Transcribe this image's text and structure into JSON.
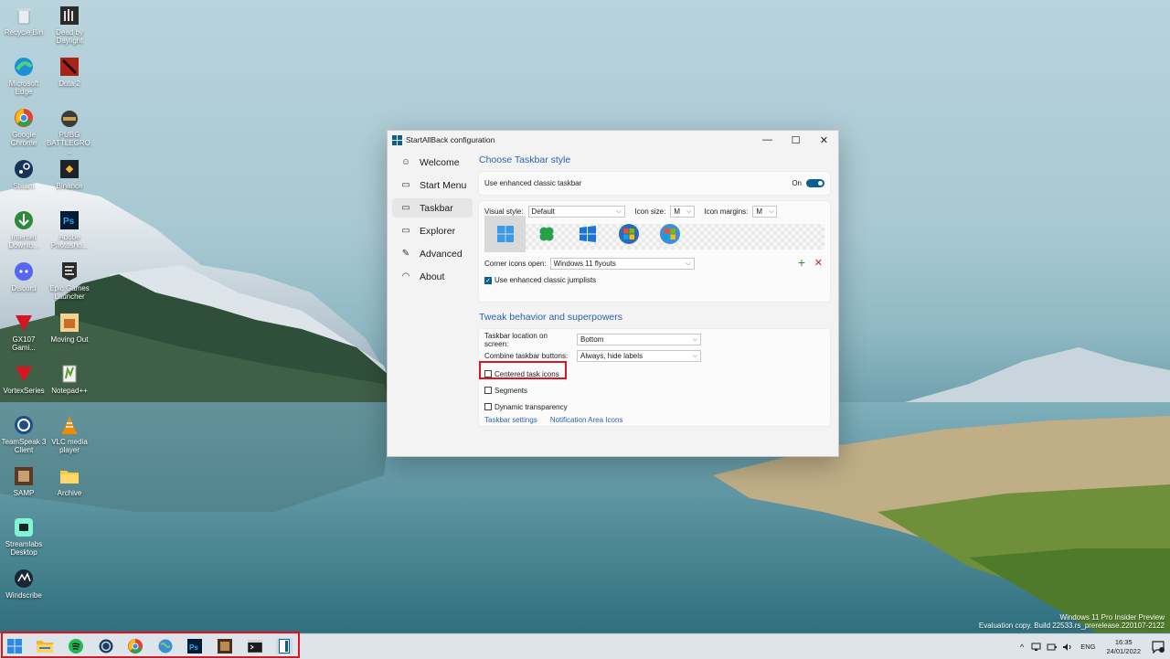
{
  "desktop": {
    "icons": [
      {
        "label": "Recycle Bin",
        "icon": "recycle-bin-icon"
      },
      {
        "label": "Dead by Daylight",
        "icon": "game-icon"
      },
      {
        "label": "Microsoft Edge",
        "icon": "edge-icon"
      },
      {
        "label": "Dota 2",
        "icon": "dota-icon"
      },
      {
        "label": "Google Chrome",
        "icon": "chrome-icon"
      },
      {
        "label": "PUBG BATTLEGRO...",
        "icon": "pubg-icon"
      },
      {
        "label": "Steam",
        "icon": "steam-icon"
      },
      {
        "label": "Binance",
        "icon": "binance-icon"
      },
      {
        "label": "Internet Downlo...",
        "icon": "idm-icon"
      },
      {
        "label": "Adobe Photosho...",
        "icon": "photoshop-icon"
      },
      {
        "label": "Discord",
        "icon": "discord-icon"
      },
      {
        "label": "Epic Games Launcher",
        "icon": "epic-icon"
      },
      {
        "label": "GX107 Gami...",
        "icon": "gx-icon"
      },
      {
        "label": "Moving Out",
        "icon": "moving-out-icon"
      },
      {
        "label": "VortexSeries",
        "icon": "vortex-icon"
      },
      {
        "label": "Notepad++",
        "icon": "notepadpp-icon"
      },
      {
        "label": "TeamSpeak 3 Client",
        "icon": "teamspeak-icon"
      },
      {
        "label": "VLC media player",
        "icon": "vlc-icon"
      },
      {
        "label": "SAMP",
        "icon": "samp-icon"
      },
      {
        "label": "Archive",
        "icon": "folder-icon"
      },
      {
        "label": "Streamlabs Desktop",
        "icon": "streamlabs-icon"
      },
      {
        "label": "Windscribe",
        "icon": "windscribe-icon"
      }
    ]
  },
  "window": {
    "title": "StartAllBack configuration",
    "controls": {
      "minimize": "—",
      "maximize": "☐",
      "close": "✕"
    },
    "nav": [
      {
        "label": "Welcome",
        "glyph": "☺"
      },
      {
        "label": "Start Menu",
        "glyph": "▭"
      },
      {
        "label": "Taskbar",
        "glyph": "▭"
      },
      {
        "label": "Explorer",
        "glyph": "▭"
      },
      {
        "label": "Advanced",
        "glyph": "✎"
      },
      {
        "label": "About",
        "glyph": "◠"
      }
    ],
    "section1": {
      "heading": "Choose Taskbar style",
      "enhanced_label": "Use enhanced classic taskbar",
      "enhanced_state": "On",
      "visual_style_label": "Visual style:",
      "visual_style_value": "Default",
      "icon_size_label": "Icon size:",
      "icon_size_value": "M",
      "icon_margins_label": "Icon margins:",
      "icon_margins_value": "M",
      "corner_label": "Corner icons open:",
      "corner_value": "Windows 11 flyouts",
      "jumplists_label": "Use enhanced classic jumplists",
      "add_glyph": "+",
      "remove_glyph": "✕"
    },
    "section2": {
      "heading": "Tweak behavior and superpowers",
      "location_label": "Taskbar location on screen:",
      "location_value": "Bottom",
      "combine_label": "Combine taskbar buttons:",
      "combine_value": "Always, hide labels",
      "centered_label": "Centered task icons",
      "segments_label": "Segments",
      "transparency_label": "Dynamic transparency",
      "link_taskbar": "Taskbar settings",
      "link_notification": "Notification Area Icons"
    }
  },
  "watermark": {
    "line1": "Windows 11 Pro Insider Preview",
    "line2": "Evaluation copy. Build 22533.rs_prerelease.220107-2122"
  },
  "tray": {
    "language": "ENG",
    "time": "16:35",
    "date": "24/01/2022",
    "chevron": "^"
  },
  "colors": {
    "accent": "#0b5f8f",
    "link": "#2c63b0",
    "highlight_box": "#e0141e"
  }
}
